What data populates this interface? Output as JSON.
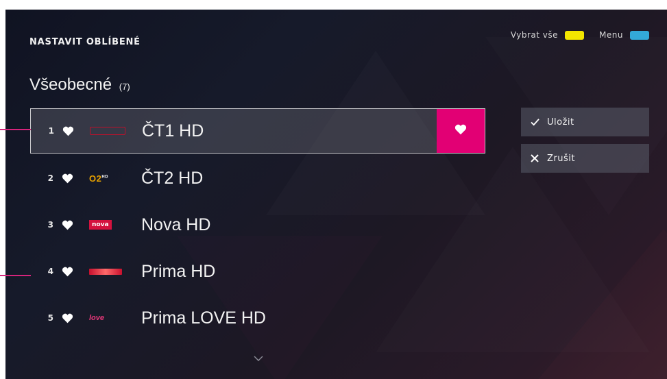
{
  "screen": {
    "title": "NASTAVIT OBLÍBENÉ",
    "hints": [
      {
        "label": "Vybrat vše",
        "color": "#f3e600"
      },
      {
        "label": "Menu",
        "color": "#33a9d8"
      }
    ]
  },
  "section": {
    "title": "Všeobecné",
    "count": "(7)"
  },
  "channels": [
    {
      "number": "1",
      "name": "ČT1 HD",
      "logo": "ct1-hd-logo",
      "favorite": true,
      "selected": true
    },
    {
      "number": "2",
      "name": "ČT2 HD",
      "logo": "ct2-hd-logo",
      "logo_text": "O2",
      "logo_sup": "HD",
      "favorite": true
    },
    {
      "number": "3",
      "name": "Nova HD",
      "logo": "nova-logo",
      "logo_text": "nova",
      "favorite": true
    },
    {
      "number": "4",
      "name": "Prima HD",
      "logo": "prima-logo",
      "favorite": true
    },
    {
      "number": "5",
      "name": "Prima LOVE HD",
      "logo": "prima-love-logo",
      "logo_text": "love",
      "favorite": true
    }
  ],
  "actions": {
    "save": {
      "label": "Uložit",
      "icon": "check-icon"
    },
    "cancel": {
      "label": "Zrušit",
      "icon": "x-icon"
    }
  },
  "colors": {
    "accent": "#e20074",
    "callout": "#d6247c"
  }
}
